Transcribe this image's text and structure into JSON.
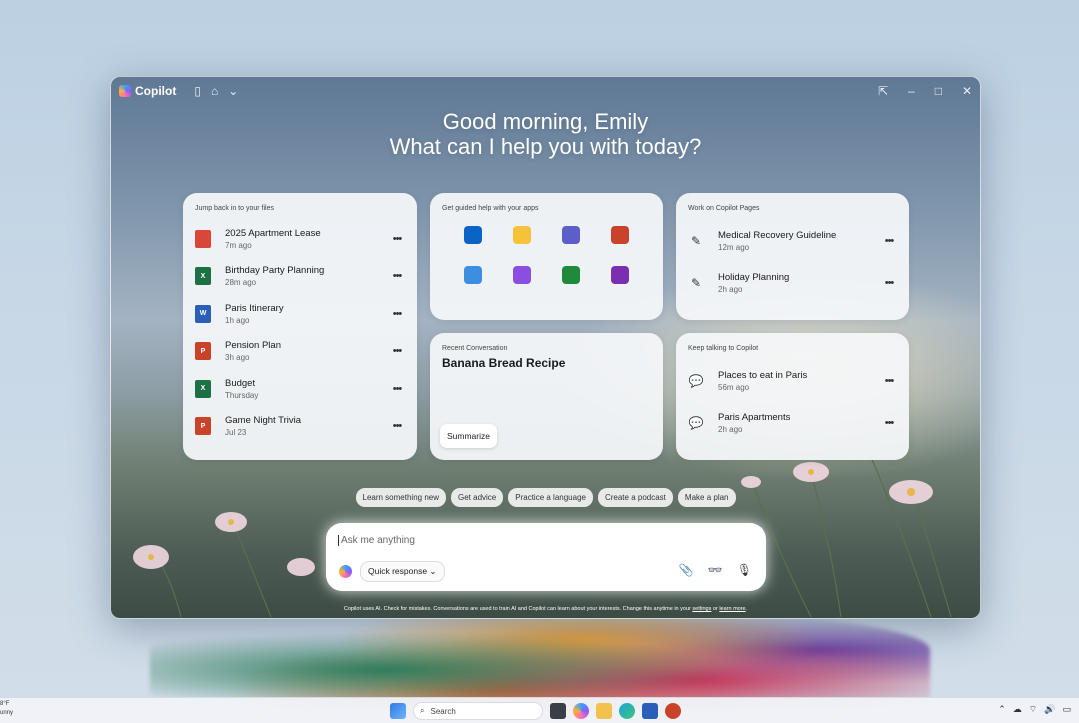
{
  "window": {
    "brand": "Copilot",
    "greeting_line1": "Good morning, Emily",
    "greeting_line2": "What can I help you with today?"
  },
  "files_card": {
    "heading": "Jump back in to your files",
    "items": [
      {
        "name": "2025 Apartment Lease",
        "time": "7m ago",
        "type": "pdf"
      },
      {
        "name": "Birthday Party Planning",
        "time": "28m ago",
        "type": "excel"
      },
      {
        "name": "Paris Itinerary",
        "time": "1h ago",
        "type": "word"
      },
      {
        "name": "Pension Plan",
        "time": "3h ago",
        "type": "powerpoint"
      },
      {
        "name": "Budget",
        "time": "Thursday",
        "type": "excel"
      },
      {
        "name": "Game Night Trivia",
        "time": "Jul 23",
        "type": "powerpoint"
      }
    ]
  },
  "apps_card": {
    "heading": "Get guided help with your apps",
    "apps": [
      "outlook-icon",
      "sticky-notes-icon",
      "teams-icon",
      "powerpoint-icon",
      "photos-icon",
      "clipchamp-icon",
      "xbox-icon",
      "onenote-icon"
    ]
  },
  "pages_card": {
    "heading": "Work on Copilot Pages",
    "items": [
      {
        "name": "Medical Recovery Guideline",
        "time": "12m ago"
      },
      {
        "name": "Holiday Planning",
        "time": "2h ago"
      }
    ]
  },
  "conversation_card": {
    "heading": "Recent Conversation",
    "title": "Banana Bread Recipe",
    "button": "Summarize"
  },
  "talk_card": {
    "heading": "Keep talking to Copilot",
    "items": [
      {
        "name": "Places to eat in Paris",
        "time": "56m ago"
      },
      {
        "name": "Paris Apartments",
        "time": "2h ago"
      }
    ]
  },
  "suggestions": [
    "Learn something new",
    "Get advice",
    "Practice a language",
    "Create a podcast",
    "Make a plan"
  ],
  "composer": {
    "placeholder": "Ask me anything",
    "mode": "Quick response"
  },
  "disclaimer_prefix": "Copilot uses AI. Check for mistakes. Conversations are used to train AI and Copilot can learn about your interests. Change this anytime in your",
  "disclaimer_settings": "settings",
  "disclaimer_or": "or",
  "disclaimer_learn": "learn more",
  "taskbar": {
    "weather_temp": "8°F",
    "weather_desc": "unny",
    "search_placeholder": "Search"
  },
  "colors": {
    "excel": "#1d7044",
    "word": "#2b5eb8",
    "powerpoint": "#c9432a",
    "pdf": "#d8473a"
  }
}
